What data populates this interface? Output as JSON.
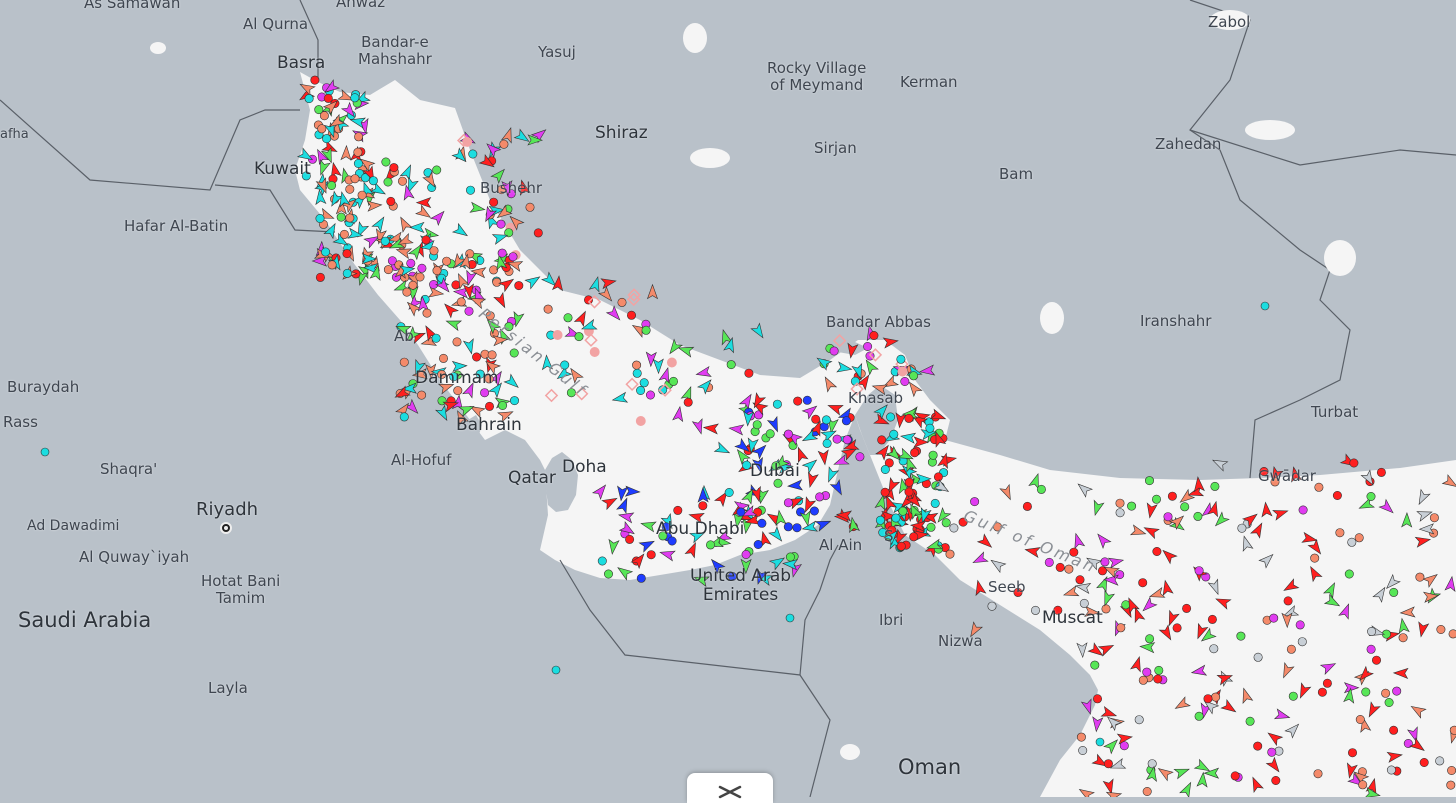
{
  "map": {
    "colors": {
      "land": "#b9c1c9",
      "water": "#f5f5f5",
      "border": "#5a6068",
      "cargo": "#57e657",
      "tanker": "#ff1f1f",
      "passenger": "#1bdde0",
      "fishing": "#f48a6a",
      "pleasure": "#e03cf0",
      "navaid": "#f2a3a3",
      "unknown": "#c8cfd6",
      "highspeed": "#1e3cff",
      "special": "#ffd900"
    }
  },
  "labels": {
    "as_samawah": "As Samawah",
    "ahwaz": "Ahwaz",
    "zabol": "Zabol",
    "al_qurna": "Al Qurna",
    "bandar_e_mahshahr": "Bandar-e\nMahshahr",
    "yasuj": "Yasuj",
    "basra": "Basra",
    "rocky_village": "Rocky Village\nof Meymand",
    "kerman": "Kerman",
    "rafha": "afha",
    "shiraz": "Shiraz",
    "zahedan": "Zahedan",
    "sirjan": "Sirjan",
    "kuwait": "Kuwait",
    "bam": "Bam",
    "bushehr": "Bushehr",
    "hafar_al_batin": "Hafar Al-Batin",
    "bandar_abbas": "Bandar Abbas",
    "iranshahr": "Iranshahr",
    "abqaiq": "Ab",
    "dammam": "Dammam",
    "buraydah": "Buraydah",
    "khasab": "Khasab",
    "turbat": "Turbat",
    "rass": "Rass",
    "bahrain": "Bahrain",
    "al_hofuf": "Al-Hofuf",
    "doha": "Doha",
    "shaqra": "Shaqra'",
    "qatar": "Qatar",
    "dubai": "Dubai",
    "gwadar": "Gwādar",
    "riyadh": "Riyadh",
    "ad_dawadimi": "Ad Dawadimi",
    "abu_dhabi": "Abu Dhabi",
    "al_ain": "Al Ain",
    "sohar": "S",
    "al_quwayiyah": "Al Quway`iyah",
    "united_arab_emirates": "United Arab\nEmirates",
    "seeb": "Seeb",
    "hotat_bani_tamim": "Hotat Bani\nTamim",
    "muscat": "Muscat",
    "saudi_arabia": "Saudi Arabia",
    "ibri": "Ibri",
    "nizwa": "Nizwa",
    "layla": "Layla",
    "oman": "Oman"
  },
  "water_labels": {
    "persian_gulf": "Persian Gulf",
    "gulf_of_oman": "Gulf of Oman"
  },
  "controls": {
    "close_icon": "close-icon",
    "capital_icon": "capital-icon"
  }
}
